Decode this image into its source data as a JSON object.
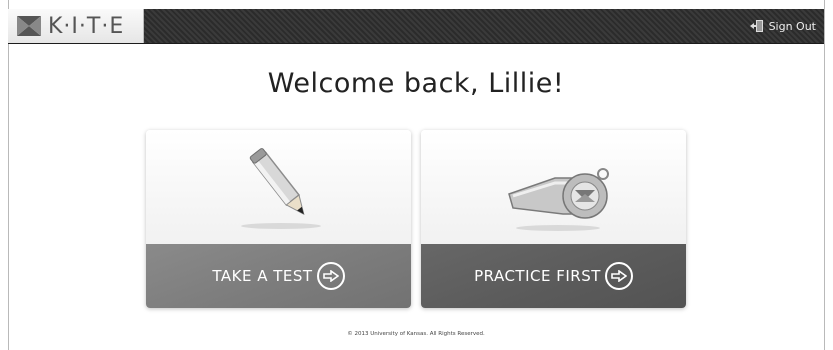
{
  "header": {
    "logo_text": "K·I·T·E",
    "signout_label": "Sign Out",
    "signout_icon": "sign-out-icon",
    "logo_icon": "kite-logo-icon"
  },
  "welcome": {
    "message": "Welcome back, Lillie!"
  },
  "cards": [
    {
      "label": "TAKE A TEST",
      "icon": "pencil-icon",
      "action_icon": "arrow-right-circle-icon"
    },
    {
      "label": "PRACTICE FIRST",
      "icon": "whistle-icon",
      "action_icon": "arrow-right-circle-icon"
    }
  ],
  "footer": {
    "copyright": "© 2013 University of Kansas. All Rights Reserved."
  },
  "colors": {
    "header_bg": "#333333",
    "card_test_bg": "#7e7e7e",
    "card_practice_bg": "#5c5c5c",
    "text_dark": "#222222"
  }
}
